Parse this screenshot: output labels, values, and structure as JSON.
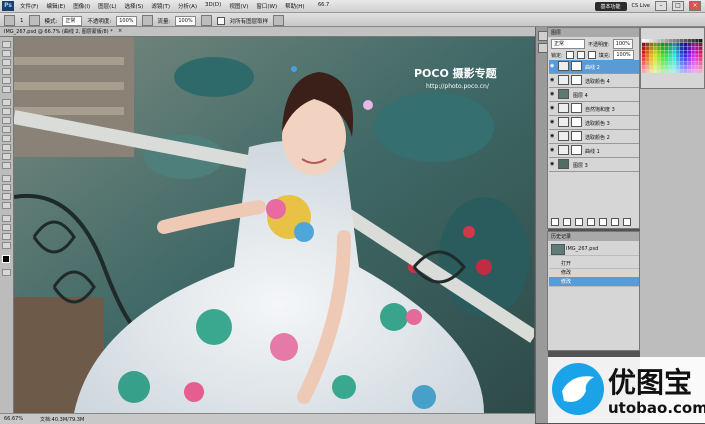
{
  "menubar": {
    "app_logo": "Ps",
    "items": [
      "文件(F)",
      "编辑(E)",
      "图像(I)",
      "图层(L)",
      "选择(S)",
      "滤镜(T)",
      "分析(A)",
      "3D(D)",
      "视图(V)",
      "窗口(W)",
      "帮助(H)"
    ],
    "workspace_button": "基本功能",
    "cslive": "CS Live",
    "zoom_value": "66.7"
  },
  "options": {
    "mode_label": "模式:",
    "mode_value": "正常",
    "opacity_label": "不透明度:",
    "opacity_value": "100%",
    "flow_label": "流量:",
    "flow_value": "100%",
    "history_checkbox_label": "对所有图层取样",
    "brush_size": "1"
  },
  "document": {
    "tab_title": "IMG_267.psd @ 66.7% (曲线 2, 图层蒙版/8) *",
    "watermark_poco": "POCO 摄影专题",
    "watermark_url": "http://photo.poco.cn/"
  },
  "status": {
    "zoom": "66.67%",
    "doc_size": "文档:40.3M/79.3M"
  },
  "layers_panel": {
    "tab_label": "图层",
    "blend_mode": "正常",
    "opacity_label": "不透明度:",
    "opacity_value": "100%",
    "lock_label": "锁定:",
    "fill_label": "填充:",
    "fill_value": "100%",
    "layers": [
      {
        "name": "曲线 2",
        "selected": true
      },
      {
        "name": "选取颜色 4",
        "selected": false
      },
      {
        "name": "图层 4",
        "selected": false
      },
      {
        "name": "自然饱和度 3",
        "selected": false
      },
      {
        "name": "选取颜色 3",
        "selected": false
      },
      {
        "name": "选取颜色 2",
        "selected": false
      },
      {
        "name": "曲线 1",
        "selected": false
      },
      {
        "name": "图层 3",
        "selected": false
      }
    ]
  },
  "history_panel": {
    "tab_label": "历史记录",
    "snapshot": "IMG_267.psd",
    "steps": [
      {
        "name": "打开",
        "selected": false
      },
      {
        "name": "修改 ",
        "selected": false
      },
      {
        "name": "修改 ",
        "selected": true
      }
    ]
  },
  "brand_watermark": {
    "name": "优图宝",
    "url": "utobao.com"
  },
  "colors": {
    "accent_blue": "#5b9bd5",
    "brand_blue": "#1aa3e8"
  }
}
